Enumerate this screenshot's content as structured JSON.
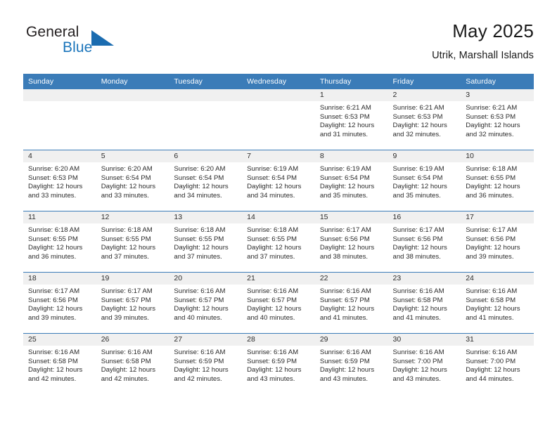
{
  "logo": {
    "word_top": "General",
    "word_bottom": "Blue",
    "icon": "triangle-flag-icon",
    "color_blue": "#1b75bb",
    "color_dark": "#231f20"
  },
  "header": {
    "title": "May 2025",
    "subtitle": "Utrik, Marshall Islands"
  },
  "theme": {
    "header_band": "#3b7cb8",
    "daynum_band": "#f0f0f0",
    "text": "#2b2b2b"
  },
  "weekday_headers": [
    "Sunday",
    "Monday",
    "Tuesday",
    "Wednesday",
    "Thursday",
    "Friday",
    "Saturday"
  ],
  "weeks": [
    [
      {
        "day": "",
        "empty": true
      },
      {
        "day": "",
        "empty": true
      },
      {
        "day": "",
        "empty": true
      },
      {
        "day": "",
        "empty": true
      },
      {
        "day": "1",
        "sunrise": "Sunrise: 6:21 AM",
        "sunset": "Sunset: 6:53 PM",
        "daylight1": "Daylight: 12 hours",
        "daylight2": "and 31 minutes."
      },
      {
        "day": "2",
        "sunrise": "Sunrise: 6:21 AM",
        "sunset": "Sunset: 6:53 PM",
        "daylight1": "Daylight: 12 hours",
        "daylight2": "and 32 minutes."
      },
      {
        "day": "3",
        "sunrise": "Sunrise: 6:21 AM",
        "sunset": "Sunset: 6:53 PM",
        "daylight1": "Daylight: 12 hours",
        "daylight2": "and 32 minutes."
      }
    ],
    [
      {
        "day": "4",
        "sunrise": "Sunrise: 6:20 AM",
        "sunset": "Sunset: 6:53 PM",
        "daylight1": "Daylight: 12 hours",
        "daylight2": "and 33 minutes."
      },
      {
        "day": "5",
        "sunrise": "Sunrise: 6:20 AM",
        "sunset": "Sunset: 6:54 PM",
        "daylight1": "Daylight: 12 hours",
        "daylight2": "and 33 minutes."
      },
      {
        "day": "6",
        "sunrise": "Sunrise: 6:20 AM",
        "sunset": "Sunset: 6:54 PM",
        "daylight1": "Daylight: 12 hours",
        "daylight2": "and 34 minutes."
      },
      {
        "day": "7",
        "sunrise": "Sunrise: 6:19 AM",
        "sunset": "Sunset: 6:54 PM",
        "daylight1": "Daylight: 12 hours",
        "daylight2": "and 34 minutes."
      },
      {
        "day": "8",
        "sunrise": "Sunrise: 6:19 AM",
        "sunset": "Sunset: 6:54 PM",
        "daylight1": "Daylight: 12 hours",
        "daylight2": "and 35 minutes."
      },
      {
        "day": "9",
        "sunrise": "Sunrise: 6:19 AM",
        "sunset": "Sunset: 6:54 PM",
        "daylight1": "Daylight: 12 hours",
        "daylight2": "and 35 minutes."
      },
      {
        "day": "10",
        "sunrise": "Sunrise: 6:18 AM",
        "sunset": "Sunset: 6:55 PM",
        "daylight1": "Daylight: 12 hours",
        "daylight2": "and 36 minutes."
      }
    ],
    [
      {
        "day": "11",
        "sunrise": "Sunrise: 6:18 AM",
        "sunset": "Sunset: 6:55 PM",
        "daylight1": "Daylight: 12 hours",
        "daylight2": "and 36 minutes."
      },
      {
        "day": "12",
        "sunrise": "Sunrise: 6:18 AM",
        "sunset": "Sunset: 6:55 PM",
        "daylight1": "Daylight: 12 hours",
        "daylight2": "and 37 minutes."
      },
      {
        "day": "13",
        "sunrise": "Sunrise: 6:18 AM",
        "sunset": "Sunset: 6:55 PM",
        "daylight1": "Daylight: 12 hours",
        "daylight2": "and 37 minutes."
      },
      {
        "day": "14",
        "sunrise": "Sunrise: 6:18 AM",
        "sunset": "Sunset: 6:55 PM",
        "daylight1": "Daylight: 12 hours",
        "daylight2": "and 37 minutes."
      },
      {
        "day": "15",
        "sunrise": "Sunrise: 6:17 AM",
        "sunset": "Sunset: 6:56 PM",
        "daylight1": "Daylight: 12 hours",
        "daylight2": "and 38 minutes."
      },
      {
        "day": "16",
        "sunrise": "Sunrise: 6:17 AM",
        "sunset": "Sunset: 6:56 PM",
        "daylight1": "Daylight: 12 hours",
        "daylight2": "and 38 minutes."
      },
      {
        "day": "17",
        "sunrise": "Sunrise: 6:17 AM",
        "sunset": "Sunset: 6:56 PM",
        "daylight1": "Daylight: 12 hours",
        "daylight2": "and 39 minutes."
      }
    ],
    [
      {
        "day": "18",
        "sunrise": "Sunrise: 6:17 AM",
        "sunset": "Sunset: 6:56 PM",
        "daylight1": "Daylight: 12 hours",
        "daylight2": "and 39 minutes."
      },
      {
        "day": "19",
        "sunrise": "Sunrise: 6:17 AM",
        "sunset": "Sunset: 6:57 PM",
        "daylight1": "Daylight: 12 hours",
        "daylight2": "and 39 minutes."
      },
      {
        "day": "20",
        "sunrise": "Sunrise: 6:16 AM",
        "sunset": "Sunset: 6:57 PM",
        "daylight1": "Daylight: 12 hours",
        "daylight2": "and 40 minutes."
      },
      {
        "day": "21",
        "sunrise": "Sunrise: 6:16 AM",
        "sunset": "Sunset: 6:57 PM",
        "daylight1": "Daylight: 12 hours",
        "daylight2": "and 40 minutes."
      },
      {
        "day": "22",
        "sunrise": "Sunrise: 6:16 AM",
        "sunset": "Sunset: 6:57 PM",
        "daylight1": "Daylight: 12 hours",
        "daylight2": "and 41 minutes."
      },
      {
        "day": "23",
        "sunrise": "Sunrise: 6:16 AM",
        "sunset": "Sunset: 6:58 PM",
        "daylight1": "Daylight: 12 hours",
        "daylight2": "and 41 minutes."
      },
      {
        "day": "24",
        "sunrise": "Sunrise: 6:16 AM",
        "sunset": "Sunset: 6:58 PM",
        "daylight1": "Daylight: 12 hours",
        "daylight2": "and 41 minutes."
      }
    ],
    [
      {
        "day": "25",
        "sunrise": "Sunrise: 6:16 AM",
        "sunset": "Sunset: 6:58 PM",
        "daylight1": "Daylight: 12 hours",
        "daylight2": "and 42 minutes."
      },
      {
        "day": "26",
        "sunrise": "Sunrise: 6:16 AM",
        "sunset": "Sunset: 6:58 PM",
        "daylight1": "Daylight: 12 hours",
        "daylight2": "and 42 minutes."
      },
      {
        "day": "27",
        "sunrise": "Sunrise: 6:16 AM",
        "sunset": "Sunset: 6:59 PM",
        "daylight1": "Daylight: 12 hours",
        "daylight2": "and 42 minutes."
      },
      {
        "day": "28",
        "sunrise": "Sunrise: 6:16 AM",
        "sunset": "Sunset: 6:59 PM",
        "daylight1": "Daylight: 12 hours",
        "daylight2": "and 43 minutes."
      },
      {
        "day": "29",
        "sunrise": "Sunrise: 6:16 AM",
        "sunset": "Sunset: 6:59 PM",
        "daylight1": "Daylight: 12 hours",
        "daylight2": "and 43 minutes."
      },
      {
        "day": "30",
        "sunrise": "Sunrise: 6:16 AM",
        "sunset": "Sunset: 7:00 PM",
        "daylight1": "Daylight: 12 hours",
        "daylight2": "and 43 minutes."
      },
      {
        "day": "31",
        "sunrise": "Sunrise: 6:16 AM",
        "sunset": "Sunset: 7:00 PM",
        "daylight1": "Daylight: 12 hours",
        "daylight2": "and 44 minutes."
      }
    ]
  ]
}
